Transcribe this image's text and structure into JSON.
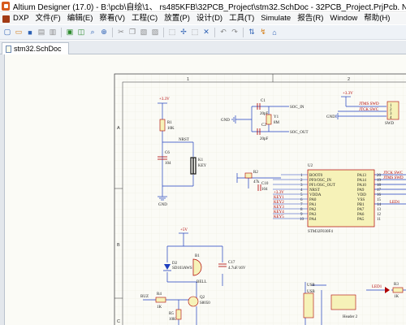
{
  "window": {
    "title": "Altium Designer (17.0) - B:\\pcb\\自绘\\1、 rs485KFB\\32PCB_Project\\stm32.SchDoc - 32PCB_Project.PrjPcb. Not signed in."
  },
  "menu": {
    "items": [
      "DXP",
      "文件(F)",
      "编辑(E)",
      "察看(V)",
      "工程(C)",
      "放置(P)",
      "设计(D)",
      "工具(T)",
      "Simulate",
      "报告(R)",
      "Window",
      "帮助(H)"
    ]
  },
  "document": {
    "tab_label": "stm32.SchDoc"
  },
  "schematic": {
    "zones": {
      "col1": "1",
      "col2": "2",
      "rowA": "A",
      "rowB": "B",
      "rowC": "C"
    },
    "power": {
      "v33_a": "+3.3V",
      "v33_b": "+3.3V",
      "v5": "+5V",
      "gnd_a": "GND",
      "gnd_b": "GND",
      "gnd_c": "GND"
    },
    "reset": {
      "r1_ref": "R1",
      "r1_val": "10K",
      "c6_ref": "C6",
      "c6_val": "104",
      "k1_ref": "K1",
      "k1_val": "KEY",
      "net": "NRST"
    },
    "osc": {
      "c1_ref": "C1",
      "c1_val": "20pF",
      "c2_ref": "C2",
      "c2_val": "20pF",
      "y1_ref": "Y1",
      "y1_val": "8M",
      "osc_in": "SOC_IN",
      "osc_out": "SOC_OUT"
    },
    "swd": {
      "l1": "JTMS SWD",
      "l2": "JTCK SWC",
      "conn": "SWD",
      "pins": [
        "1",
        "2",
        "3",
        "4"
      ]
    },
    "mcu": {
      "ref": "U2",
      "part": "STM32F030F4",
      "left_pins": [
        "BOOT0",
        "PF0/OSC_IN",
        "PF1/OSC_OUT",
        "NRST",
        "VDDA",
        "PA0",
        "PA1",
        "PA2",
        "PA3",
        "PA4"
      ],
      "right_pins": [
        "PA13",
        "PA14",
        "PA10",
        "PA9",
        "VDD",
        "VSS",
        "PB1",
        "PA7",
        "PA6",
        "PA5"
      ],
      "left_nums": [
        "1",
        "2",
        "3",
        "4",
        "5",
        "6",
        "7",
        "8",
        "9",
        "10"
      ],
      "right_nums": [
        "20",
        "19",
        "18",
        "17",
        "16",
        "15",
        "14",
        "13",
        "12",
        "11"
      ],
      "right_nets": [
        "JTCK SWC",
        "JTMS SWD",
        "",
        "",
        "",
        "",
        "LED1",
        "",
        "",
        ""
      ],
      "left_nets": [
        "",
        "",
        "",
        "",
        "+3.3V",
        "KEY1",
        "KEY2",
        "KEY3",
        "KEY4",
        "KEY5"
      ],
      "r2_ref": "R2",
      "r2_val": "47k",
      "c10_ref": "C10",
      "c10_val": "104"
    },
    "buzzer": {
      "b1_ref": "B1",
      "b1_val": "BELL",
      "d2_ref": "D2",
      "d2_val": "SD103AWS",
      "c17_ref": "C17",
      "c17_val": "4.7uF/16V",
      "q2_ref": "Q2",
      "q2_val": "S8050",
      "r4_ref": "R4",
      "r4_val": "1K",
      "r5_ref": "R5",
      "r5_val": "10K",
      "net": "BUZ"
    },
    "usb": {
      "label": "USB",
      "label2": "USB",
      "header": "Header 2"
    },
    "led": {
      "net": "LED1",
      "r_ref": "R3",
      "r_val": "1K"
    }
  },
  "colors": {
    "titlebar_bg": "#ffffff",
    "menubar_bg": "#f5f6f7",
    "toolbar_bg": "#eef2f7",
    "canvas_bg": "#fbfbf6",
    "wire": "#1f3fbf",
    "component": "#b00000",
    "component_fill": "#f6f2b8"
  }
}
